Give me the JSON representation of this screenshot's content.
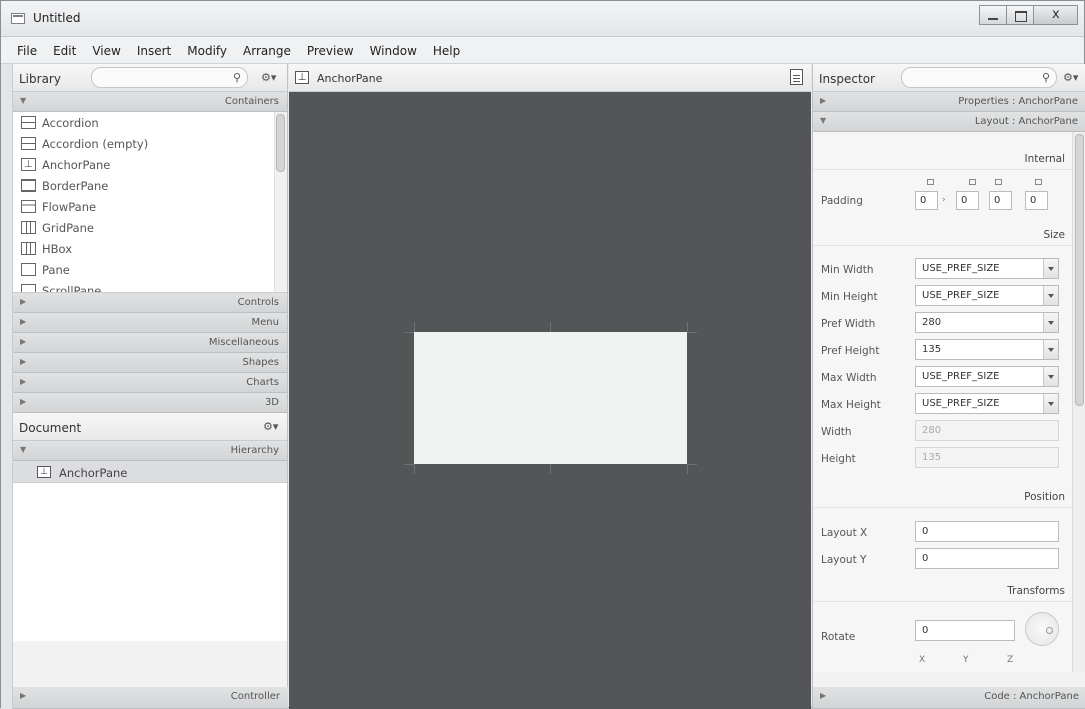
{
  "window": {
    "title": "Untitled"
  },
  "menu": [
    "File",
    "Edit",
    "View",
    "Insert",
    "Modify",
    "Arrange",
    "Preview",
    "Window",
    "Help"
  ],
  "library": {
    "title": "Library",
    "containers_label": "Containers",
    "items": [
      "Accordion",
      "Accordion  (empty)",
      "AnchorPane",
      "BorderPane",
      "FlowPane",
      "GridPane",
      "HBox",
      "Pane",
      "ScrollPane"
    ],
    "sections": [
      "Controls",
      "Menu",
      "Miscellaneous",
      "Shapes",
      "Charts",
      "3D"
    ]
  },
  "document": {
    "title": "Document",
    "hierarchy_label": "Hierarchy",
    "root_item": "AnchorPane",
    "controller_label": "Controller"
  },
  "canvas": {
    "header_label": "AnchorPane"
  },
  "inspector": {
    "title": "Inspector",
    "properties_label": "Properties : AnchorPane",
    "layout_label": "Layout : AnchorPane",
    "code_label": "Code : AnchorPane",
    "internal_label": "Internal",
    "padding_label": "Padding",
    "padding_values": [
      "0",
      "0",
      "0",
      "0"
    ],
    "size_label": "Size",
    "min_width_label": "Min Width",
    "min_width": "USE_PREF_SIZE",
    "min_height_label": "Min Height",
    "min_height": "USE_PREF_SIZE",
    "pref_width_label": "Pref Width",
    "pref_width": "280",
    "pref_height_label": "Pref Height",
    "pref_height": "135",
    "max_width_label": "Max Width",
    "max_width": "USE_PREF_SIZE",
    "max_height_label": "Max Height",
    "max_height": "USE_PREF_SIZE",
    "width_label": "Width",
    "width": "280",
    "height_label": "Height",
    "height": "135",
    "position_label": "Position",
    "layout_x_label": "Layout X",
    "layout_x": "0",
    "layout_y_label": "Layout Y",
    "layout_y": "0",
    "transforms_label": "Transforms",
    "rotate_label": "Rotate",
    "rotate": "0",
    "axis_labels": [
      "X",
      "Y",
      "Z"
    ]
  }
}
